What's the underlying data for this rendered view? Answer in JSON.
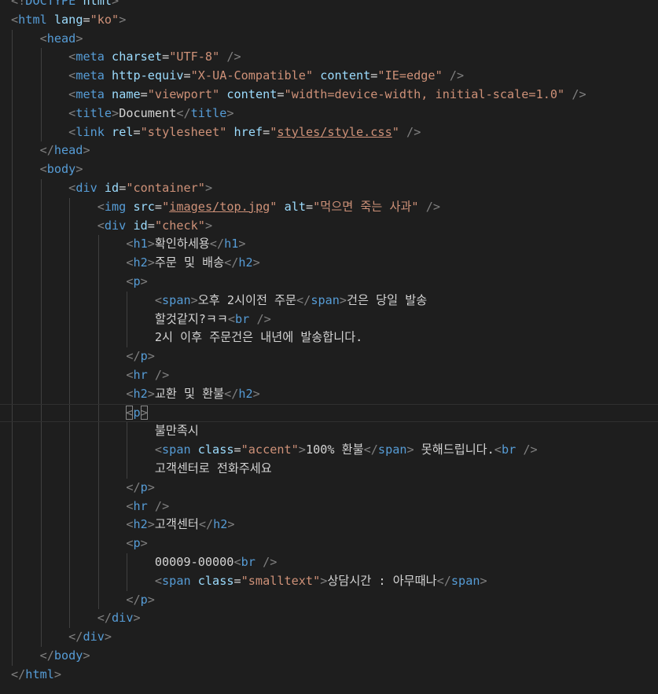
{
  "editor": {
    "theme_colors": {
      "background": "#1e1e1e",
      "tag": "#569cd6",
      "attribute": "#9cdcfe",
      "string": "#ce9178",
      "punctuation": "#808080",
      "text": "#d4d4d4"
    },
    "current_line": 22,
    "lines": [
      [
        {
          "t": "p",
          "v": "<!"
        },
        {
          "t": "tag",
          "v": "DOCTYPE"
        },
        {
          "t": "text",
          "v": " "
        },
        {
          "t": "attr",
          "v": "html"
        },
        {
          "t": "p",
          "v": ">"
        }
      ],
      [
        {
          "t": "p",
          "v": "<"
        },
        {
          "t": "tag",
          "v": "html"
        },
        {
          "t": "text",
          "v": " "
        },
        {
          "t": "attr",
          "v": "lang"
        },
        {
          "t": "eq",
          "v": "="
        },
        {
          "t": "str",
          "v": "\"ko\""
        },
        {
          "t": "p",
          "v": ">"
        }
      ],
      [
        {
          "t": "ind",
          "v": 1
        },
        {
          "t": "p",
          "v": "<"
        },
        {
          "t": "tag",
          "v": "head"
        },
        {
          "t": "p",
          "v": ">"
        }
      ],
      [
        {
          "t": "ind",
          "v": 2
        },
        {
          "t": "p",
          "v": "<"
        },
        {
          "t": "tag",
          "v": "meta"
        },
        {
          "t": "text",
          "v": " "
        },
        {
          "t": "attr",
          "v": "charset"
        },
        {
          "t": "eq",
          "v": "="
        },
        {
          "t": "str",
          "v": "\"UTF-8\""
        },
        {
          "t": "text",
          "v": " "
        },
        {
          "t": "p",
          "v": "/>"
        }
      ],
      [
        {
          "t": "ind",
          "v": 2
        },
        {
          "t": "p",
          "v": "<"
        },
        {
          "t": "tag",
          "v": "meta"
        },
        {
          "t": "text",
          "v": " "
        },
        {
          "t": "attr",
          "v": "http-equiv"
        },
        {
          "t": "eq",
          "v": "="
        },
        {
          "t": "str",
          "v": "\"X-UA-Compatible\""
        },
        {
          "t": "text",
          "v": " "
        },
        {
          "t": "attr",
          "v": "content"
        },
        {
          "t": "eq",
          "v": "="
        },
        {
          "t": "str",
          "v": "\"IE=edge\""
        },
        {
          "t": "text",
          "v": " "
        },
        {
          "t": "p",
          "v": "/>"
        }
      ],
      [
        {
          "t": "ind",
          "v": 2
        },
        {
          "t": "p",
          "v": "<"
        },
        {
          "t": "tag",
          "v": "meta"
        },
        {
          "t": "text",
          "v": " "
        },
        {
          "t": "attr",
          "v": "name"
        },
        {
          "t": "eq",
          "v": "="
        },
        {
          "t": "str",
          "v": "\"viewport\""
        },
        {
          "t": "text",
          "v": " "
        },
        {
          "t": "attr",
          "v": "content"
        },
        {
          "t": "eq",
          "v": "="
        },
        {
          "t": "str",
          "v": "\"width=device-width, initial-scale=1.0\""
        },
        {
          "t": "text",
          "v": " "
        },
        {
          "t": "p",
          "v": "/>"
        }
      ],
      [
        {
          "t": "ind",
          "v": 2
        },
        {
          "t": "p",
          "v": "<"
        },
        {
          "t": "tag",
          "v": "title"
        },
        {
          "t": "p",
          "v": ">"
        },
        {
          "t": "text",
          "v": "Document"
        },
        {
          "t": "p",
          "v": "</"
        },
        {
          "t": "tag",
          "v": "title"
        },
        {
          "t": "p",
          "v": ">"
        }
      ],
      [
        {
          "t": "ind",
          "v": 2
        },
        {
          "t": "p",
          "v": "<"
        },
        {
          "t": "tag",
          "v": "link"
        },
        {
          "t": "text",
          "v": " "
        },
        {
          "t": "attr",
          "v": "rel"
        },
        {
          "t": "eq",
          "v": "="
        },
        {
          "t": "str",
          "v": "\"stylesheet\""
        },
        {
          "t": "text",
          "v": " "
        },
        {
          "t": "attr",
          "v": "href"
        },
        {
          "t": "eq",
          "v": "="
        },
        {
          "t": "str",
          "v": "\""
        },
        {
          "t": "link",
          "v": "styles/style.css"
        },
        {
          "t": "str",
          "v": "\""
        },
        {
          "t": "text",
          "v": " "
        },
        {
          "t": "p",
          "v": "/>"
        }
      ],
      [
        {
          "t": "ind",
          "v": 1
        },
        {
          "t": "p",
          "v": "</"
        },
        {
          "t": "tag",
          "v": "head"
        },
        {
          "t": "p",
          "v": ">"
        }
      ],
      [
        {
          "t": "ind",
          "v": 1
        },
        {
          "t": "p",
          "v": "<"
        },
        {
          "t": "tag",
          "v": "body"
        },
        {
          "t": "p",
          "v": ">"
        }
      ],
      [
        {
          "t": "ind",
          "v": 2
        },
        {
          "t": "p",
          "v": "<"
        },
        {
          "t": "tag",
          "v": "div"
        },
        {
          "t": "text",
          "v": " "
        },
        {
          "t": "attr",
          "v": "id"
        },
        {
          "t": "eq",
          "v": "="
        },
        {
          "t": "str",
          "v": "\"container\""
        },
        {
          "t": "p",
          "v": ">"
        }
      ],
      [
        {
          "t": "ind",
          "v": 3
        },
        {
          "t": "p",
          "v": "<"
        },
        {
          "t": "tag",
          "v": "img"
        },
        {
          "t": "text",
          "v": " "
        },
        {
          "t": "attr",
          "v": "src"
        },
        {
          "t": "eq",
          "v": "="
        },
        {
          "t": "str",
          "v": "\""
        },
        {
          "t": "link",
          "v": "images/top.jpg"
        },
        {
          "t": "str",
          "v": "\""
        },
        {
          "t": "text",
          "v": " "
        },
        {
          "t": "attr",
          "v": "alt"
        },
        {
          "t": "eq",
          "v": "="
        },
        {
          "t": "str",
          "v": "\"먹으면 죽는 사과\""
        },
        {
          "t": "text",
          "v": " "
        },
        {
          "t": "p",
          "v": "/>"
        }
      ],
      [
        {
          "t": "ind",
          "v": 3
        },
        {
          "t": "p",
          "v": "<"
        },
        {
          "t": "tag",
          "v": "div"
        },
        {
          "t": "text",
          "v": " "
        },
        {
          "t": "attr",
          "v": "id"
        },
        {
          "t": "eq",
          "v": "="
        },
        {
          "t": "str",
          "v": "\"check\""
        },
        {
          "t": "p",
          "v": ">"
        }
      ],
      [
        {
          "t": "ind",
          "v": 4
        },
        {
          "t": "p",
          "v": "<"
        },
        {
          "t": "tag",
          "v": "h1"
        },
        {
          "t": "p",
          "v": ">"
        },
        {
          "t": "text",
          "v": "확인하세용"
        },
        {
          "t": "p",
          "v": "</"
        },
        {
          "t": "tag",
          "v": "h1"
        },
        {
          "t": "p",
          "v": ">"
        }
      ],
      [
        {
          "t": "ind",
          "v": 4
        },
        {
          "t": "p",
          "v": "<"
        },
        {
          "t": "tag",
          "v": "h2"
        },
        {
          "t": "p",
          "v": ">"
        },
        {
          "t": "text",
          "v": "주문 및 배송"
        },
        {
          "t": "p",
          "v": "</"
        },
        {
          "t": "tag",
          "v": "h2"
        },
        {
          "t": "p",
          "v": ">"
        }
      ],
      [
        {
          "t": "ind",
          "v": 4
        },
        {
          "t": "p",
          "v": "<"
        },
        {
          "t": "tag",
          "v": "p"
        },
        {
          "t": "p",
          "v": ">"
        }
      ],
      [
        {
          "t": "ind",
          "v": 5
        },
        {
          "t": "p",
          "v": "<"
        },
        {
          "t": "tag",
          "v": "span"
        },
        {
          "t": "p",
          "v": ">"
        },
        {
          "t": "text",
          "v": "오후 2시이전 주문"
        },
        {
          "t": "p",
          "v": "</"
        },
        {
          "t": "tag",
          "v": "span"
        },
        {
          "t": "p",
          "v": ">"
        },
        {
          "t": "text",
          "v": "건은 당일 발송"
        }
      ],
      [
        {
          "t": "ind",
          "v": 5
        },
        {
          "t": "text",
          "v": "할것같지?ㅋㅋ"
        },
        {
          "t": "p",
          "v": "<"
        },
        {
          "t": "tag",
          "v": "br"
        },
        {
          "t": "text",
          "v": " "
        },
        {
          "t": "p",
          "v": "/>"
        }
      ],
      [
        {
          "t": "ind",
          "v": 5
        },
        {
          "t": "text",
          "v": "2시 이후 주문건은 내년에 발송합니다."
        }
      ],
      [
        {
          "t": "ind",
          "v": 4
        },
        {
          "t": "p",
          "v": "</"
        },
        {
          "t": "tag",
          "v": "p"
        },
        {
          "t": "p",
          "v": ">"
        }
      ],
      [
        {
          "t": "ind",
          "v": 4
        },
        {
          "t": "p",
          "v": "<"
        },
        {
          "t": "tag",
          "v": "hr"
        },
        {
          "t": "text",
          "v": " "
        },
        {
          "t": "p",
          "v": "/>"
        }
      ],
      [
        {
          "t": "ind",
          "v": 4
        },
        {
          "t": "p",
          "v": "<"
        },
        {
          "t": "tag",
          "v": "h2"
        },
        {
          "t": "p",
          "v": ">"
        },
        {
          "t": "text",
          "v": "교환 및 환불"
        },
        {
          "t": "p",
          "v": "</"
        },
        {
          "t": "tag",
          "v": "h2"
        },
        {
          "t": "p",
          "v": ">"
        }
      ],
      [
        {
          "t": "ind",
          "v": 4
        },
        {
          "t": "pm",
          "v": "<"
        },
        {
          "t": "tag",
          "v": "p"
        },
        {
          "t": "pm",
          "v": ">"
        }
      ],
      [
        {
          "t": "ind",
          "v": 5
        },
        {
          "t": "text",
          "v": "불만족시"
        }
      ],
      [
        {
          "t": "ind",
          "v": 5
        },
        {
          "t": "p",
          "v": "<"
        },
        {
          "t": "tag",
          "v": "span"
        },
        {
          "t": "text",
          "v": " "
        },
        {
          "t": "attr",
          "v": "class"
        },
        {
          "t": "eq",
          "v": "="
        },
        {
          "t": "str",
          "v": "\"accent\""
        },
        {
          "t": "p",
          "v": ">"
        },
        {
          "t": "text",
          "v": "100% 환불"
        },
        {
          "t": "p",
          "v": "</"
        },
        {
          "t": "tag",
          "v": "span"
        },
        {
          "t": "p",
          "v": ">"
        },
        {
          "t": "text",
          "v": " 못해드립니다."
        },
        {
          "t": "p",
          "v": "<"
        },
        {
          "t": "tag",
          "v": "br"
        },
        {
          "t": "text",
          "v": " "
        },
        {
          "t": "p",
          "v": "/>"
        }
      ],
      [
        {
          "t": "ind",
          "v": 5
        },
        {
          "t": "text",
          "v": "고객센터로 전화주세요"
        }
      ],
      [
        {
          "t": "ind",
          "v": 4
        },
        {
          "t": "p",
          "v": "</"
        },
        {
          "t": "tag",
          "v": "p"
        },
        {
          "t": "p",
          "v": ">"
        }
      ],
      [
        {
          "t": "ind",
          "v": 4
        },
        {
          "t": "p",
          "v": "<"
        },
        {
          "t": "tag",
          "v": "hr"
        },
        {
          "t": "text",
          "v": " "
        },
        {
          "t": "p",
          "v": "/>"
        }
      ],
      [
        {
          "t": "ind",
          "v": 4
        },
        {
          "t": "p",
          "v": "<"
        },
        {
          "t": "tag",
          "v": "h2"
        },
        {
          "t": "p",
          "v": ">"
        },
        {
          "t": "text",
          "v": "고객센터"
        },
        {
          "t": "p",
          "v": "</"
        },
        {
          "t": "tag",
          "v": "h2"
        },
        {
          "t": "p",
          "v": ">"
        }
      ],
      [
        {
          "t": "ind",
          "v": 4
        },
        {
          "t": "p",
          "v": "<"
        },
        {
          "t": "tag",
          "v": "p"
        },
        {
          "t": "p",
          "v": ">"
        }
      ],
      [
        {
          "t": "ind",
          "v": 5
        },
        {
          "t": "text",
          "v": "00009-00000"
        },
        {
          "t": "p",
          "v": "<"
        },
        {
          "t": "tag",
          "v": "br"
        },
        {
          "t": "text",
          "v": " "
        },
        {
          "t": "p",
          "v": "/>"
        }
      ],
      [
        {
          "t": "ind",
          "v": 5
        },
        {
          "t": "p",
          "v": "<"
        },
        {
          "t": "tag",
          "v": "span"
        },
        {
          "t": "text",
          "v": " "
        },
        {
          "t": "attr",
          "v": "class"
        },
        {
          "t": "eq",
          "v": "="
        },
        {
          "t": "str",
          "v": "\"smalltext\""
        },
        {
          "t": "p",
          "v": ">"
        },
        {
          "t": "text",
          "v": "상담시간 : 아무때나"
        },
        {
          "t": "p",
          "v": "</"
        },
        {
          "t": "tag",
          "v": "span"
        },
        {
          "t": "p",
          "v": ">"
        }
      ],
      [
        {
          "t": "ind",
          "v": 4
        },
        {
          "t": "p",
          "v": "</"
        },
        {
          "t": "tag",
          "v": "p"
        },
        {
          "t": "p",
          "v": ">"
        }
      ],
      [
        {
          "t": "ind",
          "v": 3
        },
        {
          "t": "p",
          "v": "</"
        },
        {
          "t": "tag",
          "v": "div"
        },
        {
          "t": "p",
          "v": ">"
        }
      ],
      [
        {
          "t": "ind",
          "v": 2
        },
        {
          "t": "p",
          "v": "</"
        },
        {
          "t": "tag",
          "v": "div"
        },
        {
          "t": "p",
          "v": ">"
        }
      ],
      [
        {
          "t": "ind",
          "v": 1
        },
        {
          "t": "p",
          "v": "</"
        },
        {
          "t": "tag",
          "v": "body"
        },
        {
          "t": "p",
          "v": ">"
        }
      ],
      [
        {
          "t": "p",
          "v": "</"
        },
        {
          "t": "tag",
          "v": "html"
        },
        {
          "t": "p",
          "v": ">"
        }
      ]
    ]
  }
}
